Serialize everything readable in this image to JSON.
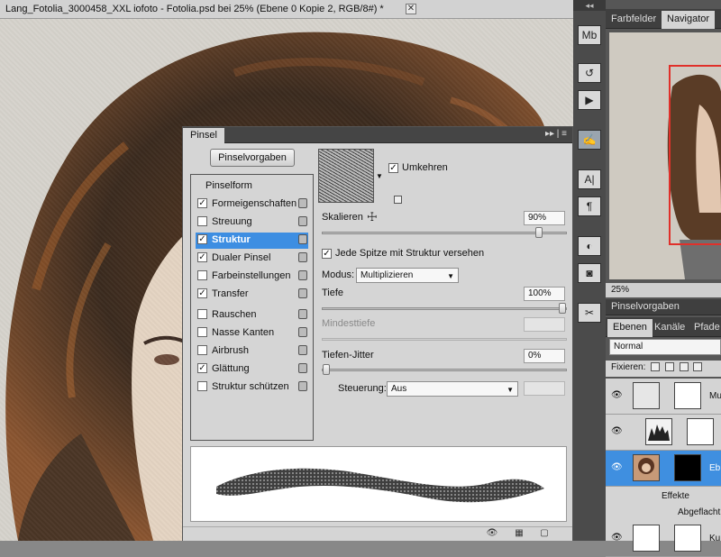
{
  "document": {
    "title": "Lang_Fotolia_3000458_XXL iofoto - Fotolia.psd bei 25% (Ebene 0 Kopie 2, RGB/8#) *",
    "close": "✕"
  },
  "tool_strip": {
    "header": "◂◂",
    "tools": [
      {
        "icon": "mini-bridge-icon",
        "glyph": "Mb"
      },
      {
        "icon": "history-icon",
        "glyph": "↺"
      },
      {
        "icon": "actions-icon",
        "glyph": "▶"
      },
      {
        "icon": "brush-panel-icon",
        "glyph": "✍"
      },
      {
        "icon": "character-icon",
        "glyph": "A|"
      },
      {
        "icon": "paragraph-icon",
        "glyph": "¶"
      },
      {
        "icon": "adjustments-icon",
        "glyph": "◐"
      },
      {
        "icon": "masks-icon",
        "glyph": "◙"
      },
      {
        "icon": "tool-presets-icon",
        "glyph": "✂"
      }
    ]
  },
  "right_panel": {
    "top_tabs": [
      "Farbfelder",
      "Navigator"
    ],
    "active_top_tab": "Navigator",
    "nav_zoom": "25%",
    "mid_tab": "Pinselvorgaben",
    "layer_tabs": [
      "Ebenen",
      "Kanäle",
      "Pfade"
    ],
    "blend_mode": "Normal",
    "lock_label": "Fixieren:",
    "layers": [
      {
        "name": "Mu",
        "visible": "👁"
      },
      {
        "name": "",
        "visible": "👁"
      },
      {
        "name": "Eb",
        "visible": "👁"
      },
      {
        "name": "Ku",
        "visible": "👁"
      }
    ],
    "effects_label": "Effekte",
    "effect_item": "Abgeflacht"
  },
  "brush_dialog": {
    "tab": "Pinsel",
    "controls": "▸▸ | ≡",
    "presets_button": "Pinselvorgaben",
    "list_header": "Pinselform",
    "items": [
      {
        "label": "Formeigenschaften",
        "checked": "✓"
      },
      {
        "label": "Streuung",
        "checked": ""
      },
      {
        "label": "Struktur",
        "checked": "✓"
      },
      {
        "label": "Dualer Pinsel",
        "checked": "✓"
      },
      {
        "label": "Farbeinstellungen",
        "checked": ""
      },
      {
        "label": "Transfer",
        "checked": "✓"
      },
      {
        "label": "Rauschen",
        "checked": ""
      },
      {
        "label": "Nasse Kanten",
        "checked": ""
      },
      {
        "label": "Airbrush",
        "checked": ""
      },
      {
        "label": "Glättung",
        "checked": "✓"
      },
      {
        "label": "Struktur schützen",
        "checked": ""
      }
    ],
    "active_item": "Struktur",
    "invert_label": "Umkehren",
    "invert_check": "✓",
    "scale_label": "Skalieren",
    "scale_value": "90%",
    "scale_level": 0.9,
    "each_tip_label": "Jede Spitze mit Struktur versehen",
    "each_tip_check": "✓",
    "mode_label": "Modus:",
    "mode_value": "Multiplizieren",
    "depth_label": "Tiefe",
    "depth_value": "100%",
    "depth_level": 1.0,
    "min_depth_label": "Mindesttiefe",
    "jitter_label": "Tiefen-Jitter",
    "jitter_value": "0%",
    "jitter_level": 0.0,
    "control_label": "Steuerung:",
    "control_value": "Aus"
  }
}
